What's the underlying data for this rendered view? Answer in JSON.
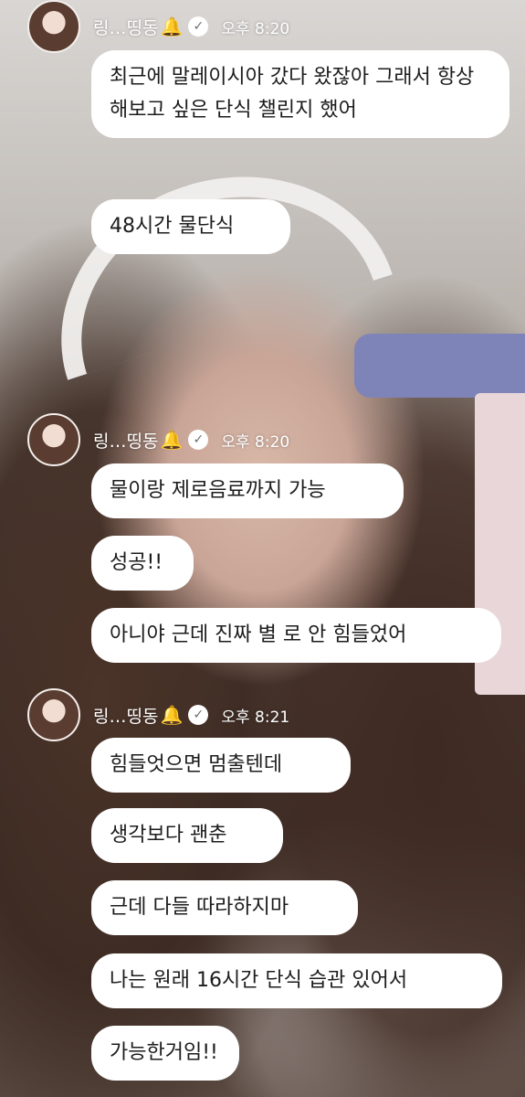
{
  "groups": [
    {
      "name": "링…띵동",
      "time": "오후 8:20",
      "messages": [
        "최근에 말레이시아 갔다 왔잖아 그래서 항상 해보고 싶은 단식 챌린지 했어",
        "48시간 물단식"
      ]
    },
    {
      "name": "링…띵동",
      "time": "오후 8:20",
      "messages": [
        "물이랑 제로음료까지 가능",
        "성공!!",
        "아니야 근데 진짜 별 로 안 힘들었어"
      ]
    },
    {
      "name": "링…띵동",
      "time": "오후 8:21",
      "messages": [
        "힘들엇으면 멈출텐데",
        "생각보다 괜춘",
        "근데 다들 따라하지마",
        "나는 원래 16시간 단식 습관 있어서",
        "가능한거임!!"
      ]
    }
  ],
  "icons": {
    "notify": "bell-icon",
    "badge": "verified-check-icon"
  },
  "colors": {
    "bubble": "#ffffff",
    "bubble_text": "#1c1c1c",
    "header_text": "#ffffff",
    "bell": "#e8b74a"
  }
}
